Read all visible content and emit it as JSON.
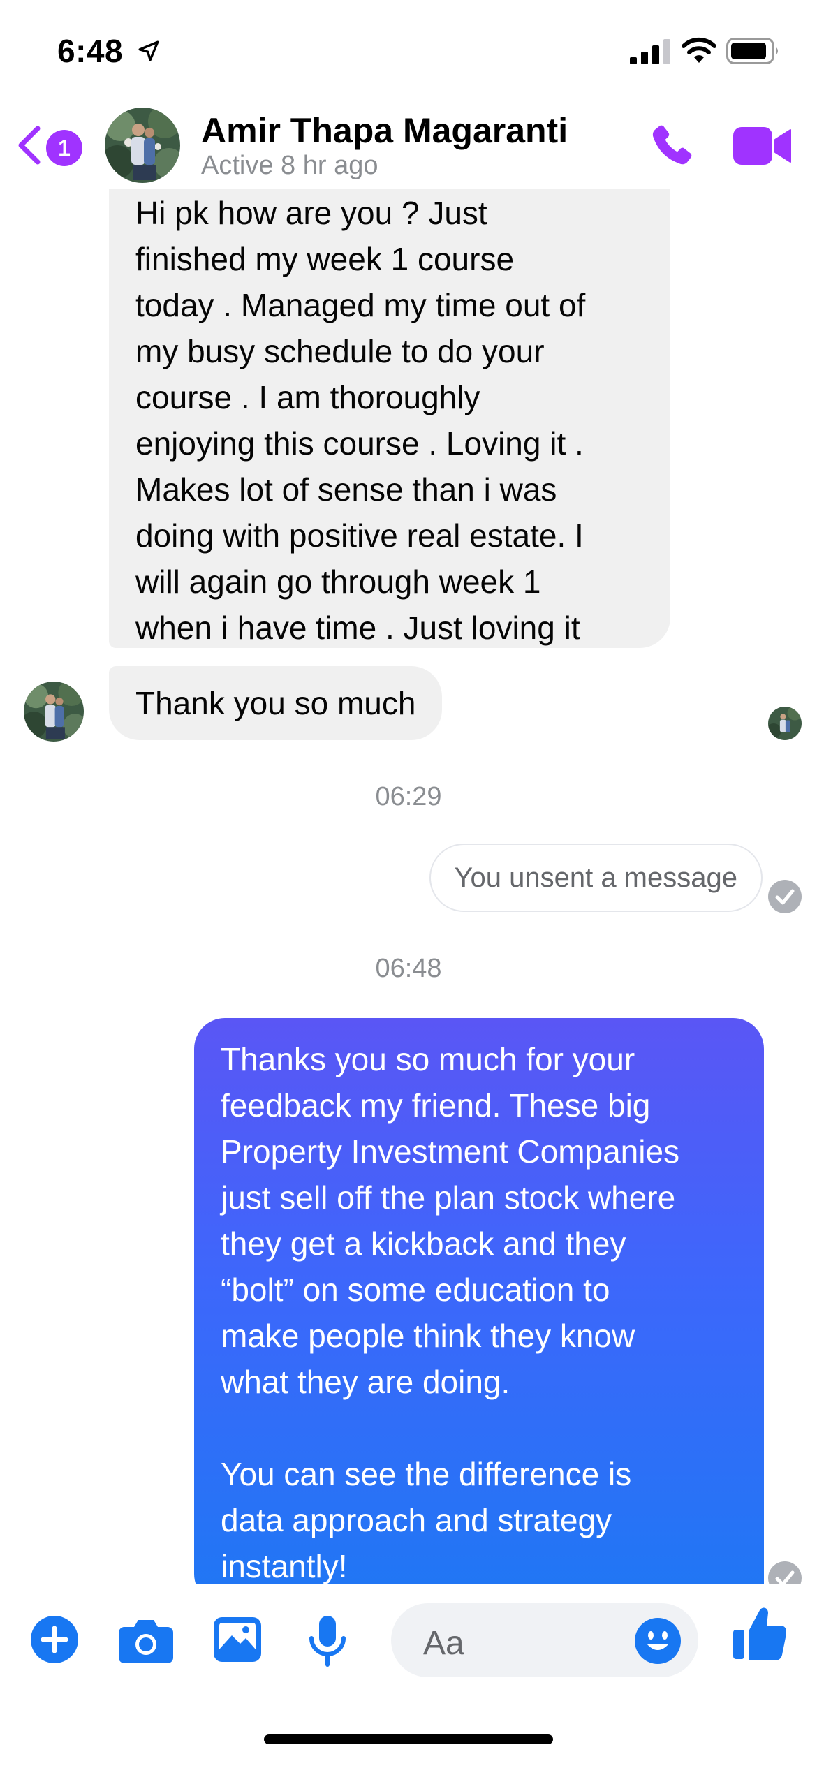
{
  "status_bar": {
    "time": "6:48"
  },
  "header": {
    "back_badge": "1",
    "contact_name": "Amir Thapa Magaranti",
    "active_status": "Active 8 hr ago"
  },
  "messages": {
    "incoming_1_lines": [
      "Hi pk how are you ? Just",
      "finished my week 1 course",
      "today . Managed my time out of",
      "my busy schedule to do your",
      "course . I am thoroughly",
      "enjoying this course . Loving it .",
      "Makes lot of sense than i was",
      "doing with positive real estate. I",
      "will again go through week 1",
      "when i have time . Just loving it"
    ],
    "incoming_2": "Thank you so much",
    "timestamp_1": "06:29",
    "unsent_notice": "You unsent a message",
    "timestamp_2": "06:48",
    "outgoing_1_lines": [
      "Thanks you so much for your",
      "feedback my friend. These big",
      "Property Investment Companies",
      "just sell off the plan stock where",
      "they get a kickback and they",
      "“bolt” on some education to",
      "make people think they know",
      "what they are doing.",
      "",
      "You can see the difference is",
      "data approach and strategy",
      "instantly!"
    ]
  },
  "composer": {
    "placeholder": "Aa"
  },
  "colors": {
    "accent": "#a033ff",
    "blue": "#1877f2",
    "outgoing_top": "#5a56f5",
    "outgoing_bottom": "#1f77f4",
    "incoming_bg": "#f0f0f0"
  },
  "icons": {
    "status": [
      "location-arrow-icon",
      "signal-icon",
      "wifi-icon",
      "battery-icon"
    ],
    "header": [
      "back-chevron-icon",
      "phone-icon",
      "video-camera-icon"
    ],
    "composer": [
      "plus-icon",
      "camera-icon",
      "gallery-icon",
      "microphone-icon",
      "emoji-icon",
      "thumbs-up-icon"
    ]
  }
}
